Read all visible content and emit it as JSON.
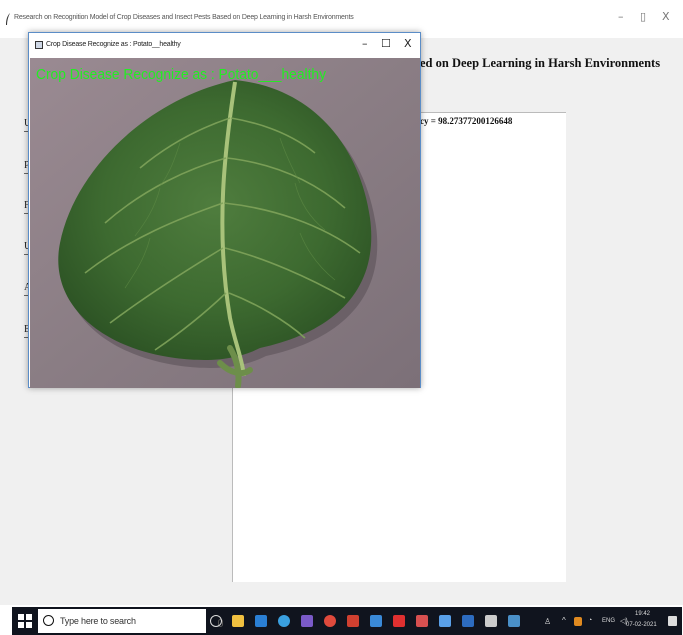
{
  "main_window": {
    "title": "Research on Recognition Model of Crop Diseases and Insect Pests Based on Deep Learning in Harsh Environments",
    "heading_visible": "ed on Deep Learning in Harsh Environments",
    "accuracy_visible": "cy = 98.27377200126648",
    "minimize": "–",
    "maximize": "▯",
    "close": "X",
    "side_letters": [
      "U",
      "P",
      "F",
      "U",
      "A",
      "E"
    ]
  },
  "popup": {
    "title": "Crop Disease Recognize as : Potato__healthy",
    "overlay_text": "Crop Disease Recognize as : Potato___healthy",
    "minimize": "–",
    "maximize": "☐",
    "close": "X"
  },
  "taskbar": {
    "search_placeholder": "Type here to search",
    "time": "19:42",
    "date": "07-02-2021",
    "tray": "ENG"
  },
  "colors": {
    "overlay_text": "#22ee22",
    "taskbar_bg": "#10141e",
    "window_bg": "#f0f0f0"
  }
}
